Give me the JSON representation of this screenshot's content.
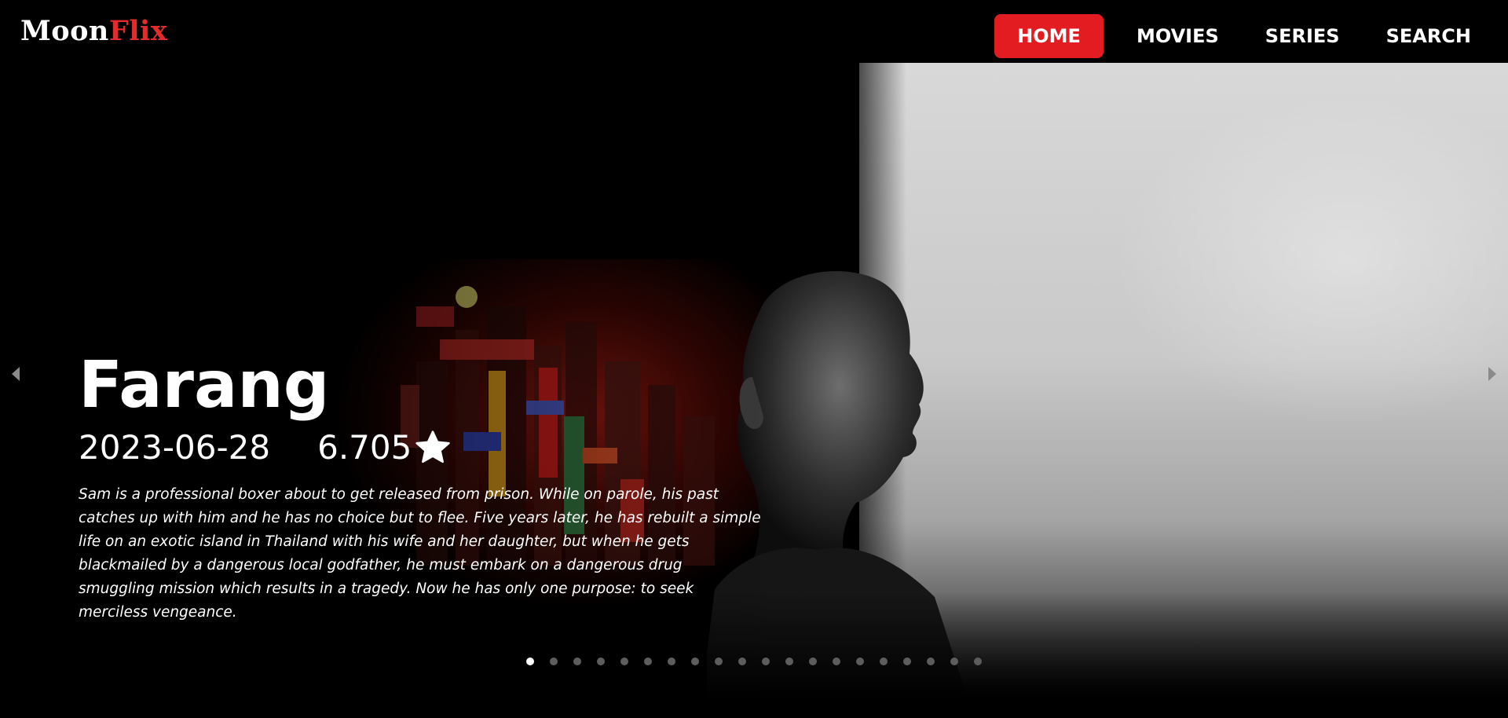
{
  "app": {
    "logo_part1": "Moon",
    "logo_part2": "Flix"
  },
  "nav": {
    "items": [
      {
        "label": "HOME",
        "active": true
      },
      {
        "label": "MOVIES",
        "active": false
      },
      {
        "label": "SERIES",
        "active": false
      },
      {
        "label": "SEARCH",
        "active": false
      }
    ]
  },
  "hero": {
    "title": "Farang",
    "release_date": "2023-06-28",
    "rating": "6.705",
    "rating_icon": "star-icon",
    "overview": "Sam is a professional boxer about to get released from prison. While on parole, his past catches up with him and he has no choice but to flee. Five years later, he has rebuilt a simple life on an exotic island in Thailand with his wife and her daughter, but when he gets blackmailed by a dangerous local godfather, he must embark on a dangerous drug smuggling mission which results in a tragedy. Now he has only one purpose: to seek merciless vengeance."
  },
  "carousel": {
    "prev_icon": "caret-left-icon",
    "next_icon": "caret-right-icon",
    "slide_count": 20,
    "active_index": 0
  },
  "colors": {
    "accent": "#e31c22",
    "logo_accent": "#e32b2b",
    "background": "#000000",
    "text": "#ffffff",
    "dot_inactive": "#5d5d5d"
  }
}
